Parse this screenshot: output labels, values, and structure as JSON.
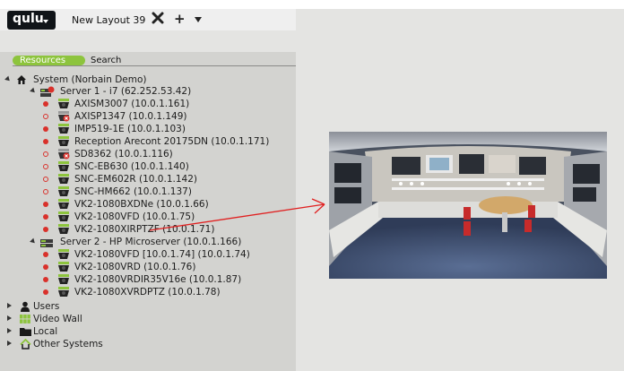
{
  "app": {
    "logo_text": "qulu",
    "layout_tab": "New Layout 39"
  },
  "panel": {
    "tab_resources": "Resources",
    "tab_search": "Search"
  },
  "tree": {
    "system": "System (Norbain Demo)",
    "server1": "Server 1 - i7 (62.252.53.42)",
    "server1_cameras": [
      "AXISM3007 (10.0.1.161)",
      "AXISP1347 (10.0.1.149)",
      "IMP519-1E (10.0.1.103)",
      "Reception Arecont 20175DN (10.0.1.171)",
      "SD8362 (10.0.1.116)",
      "SNC-EB630 (10.0.1.140)",
      "SNC-EM602R (10.0.1.142)",
      "SNC-HM662 (10.0.1.137)",
      "VK2-1080BXDNe (10.0.1.66)",
      "VK2-1080VFD (10.0.1.75)",
      "VK2-1080XIRPTZF (10.0.1.71)"
    ],
    "server2": "Server 2 - HP Microserver (10.0.1.166)",
    "server2_cameras": [
      "VK2-1080VFD [10.0.1.74] (10.0.1.74)",
      "VK2-1080VRD (10.0.1.76)",
      "VK2-1080VRDIR35V16e (10.0.1.87)",
      "VK2-1080XVRDPTZ (10.0.1.78)"
    ],
    "users": "Users",
    "video_wall": "Video Wall",
    "local": "Local",
    "other_systems": "Other Systems"
  },
  "colors": {
    "accent_green": "#8dc43d",
    "record_red": "#d9312b",
    "arrow_red": "#e02020"
  }
}
